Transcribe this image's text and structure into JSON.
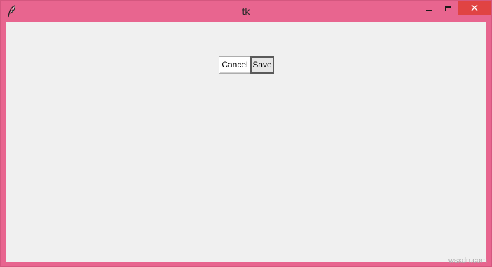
{
  "window": {
    "title": "tk",
    "frame_color": "#e8658f",
    "client_bg": "#f0f0f0",
    "close_button_color": "#e04343"
  },
  "titlebar": {
    "app_icon": "feather-icon",
    "controls": {
      "minimize_icon": "minimize-icon",
      "maximize_icon": "maximize-icon",
      "close_icon": "close-icon"
    }
  },
  "main": {
    "buttons": {
      "cancel_label": "Cancel",
      "save_label": "Save"
    }
  },
  "watermark": {
    "text": "wsxdn.com"
  }
}
